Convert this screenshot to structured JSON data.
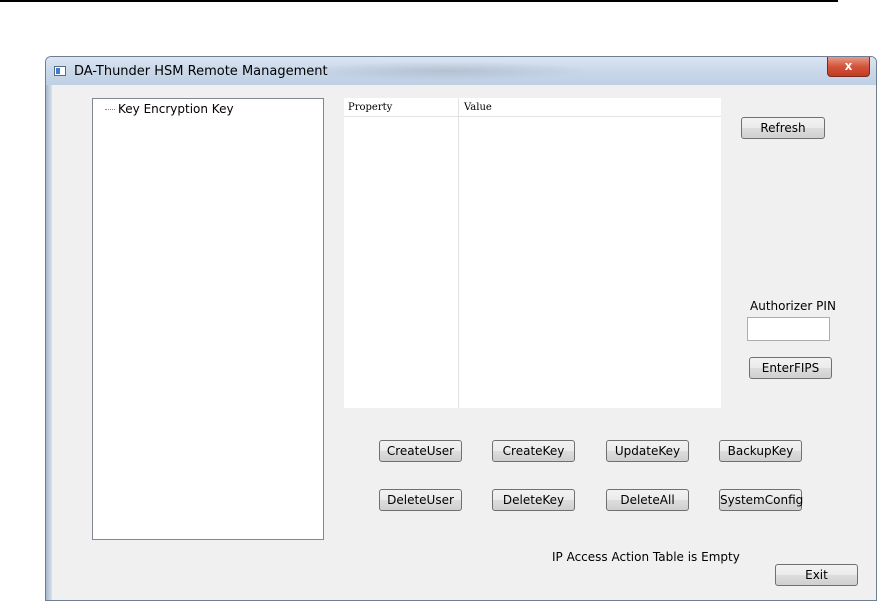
{
  "window": {
    "title": "DA-Thunder HSM Remote Management",
    "close_glyph": "x"
  },
  "tree": {
    "items": [
      {
        "label": "Key Encryption Key"
      }
    ]
  },
  "property_table": {
    "columns": [
      "Property",
      "Value"
    ],
    "rows": []
  },
  "buttons": {
    "refresh": "Refresh",
    "enter_fips": "EnterFIPS",
    "create_user": "CreateUser",
    "create_key": "CreateKey",
    "update_key": "UpdateKey",
    "backup_key": "BackupKey",
    "delete_user": "DeleteUser",
    "delete_key": "DeleteKey",
    "delete_all": "DeleteAll",
    "system_config": "SystemConfig",
    "exit": "Exit"
  },
  "authorizer": {
    "label": "Authorizer PIN",
    "value": ""
  },
  "status": {
    "message": "IP Access Action Table is Empty"
  },
  "colors": {
    "close_button": "#c23a22",
    "titlebar": "#c9d8ea"
  }
}
